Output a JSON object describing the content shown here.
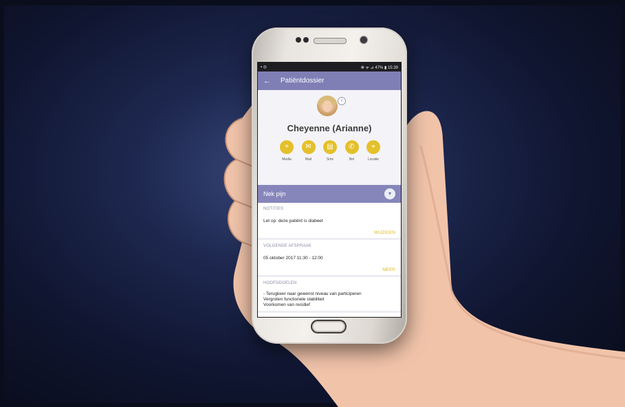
{
  "status": {
    "left_icons": "▪ ◎",
    "right": "✻ ᯤ ⊿ 47% ▮ 15:39"
  },
  "appbar": {
    "back_icon": "←",
    "title": "Patiëntdossier"
  },
  "patient": {
    "name": "Cheyenne (Arianne)",
    "info_icon": "i"
  },
  "actions": [
    {
      "icon": "+",
      "label": "Media"
    },
    {
      "icon": "✉",
      "label": "Mail"
    },
    {
      "icon": "▤",
      "label": "Sms"
    },
    {
      "icon": "✆",
      "label": "Bel"
    },
    {
      "icon": "⌖",
      "label": "Locatie"
    }
  ],
  "complaint": {
    "label": "Nek pijn",
    "toggle_icon": "▾"
  },
  "notes": {
    "heading": "NOTITIES",
    "text": "Let op: deze patiënt is diabeet",
    "action": "WIJZIGEN"
  },
  "appointment": {
    "heading": "VOLGENDE AFSPRAAK",
    "text": "05 oktober 2017  11:30 - 12:00",
    "action": "MEER"
  },
  "goals": {
    "heading": "HOOFDDOELEN",
    "items": [
      "- Terugkeer naar gewenst niveau van participeren",
      "Vergroten functionele stabiliteit",
      "Voorkomen van recidief"
    ]
  },
  "colors": {
    "accent": "#e4c02a",
    "header": "#7f7fb6",
    "background": "#101631"
  }
}
